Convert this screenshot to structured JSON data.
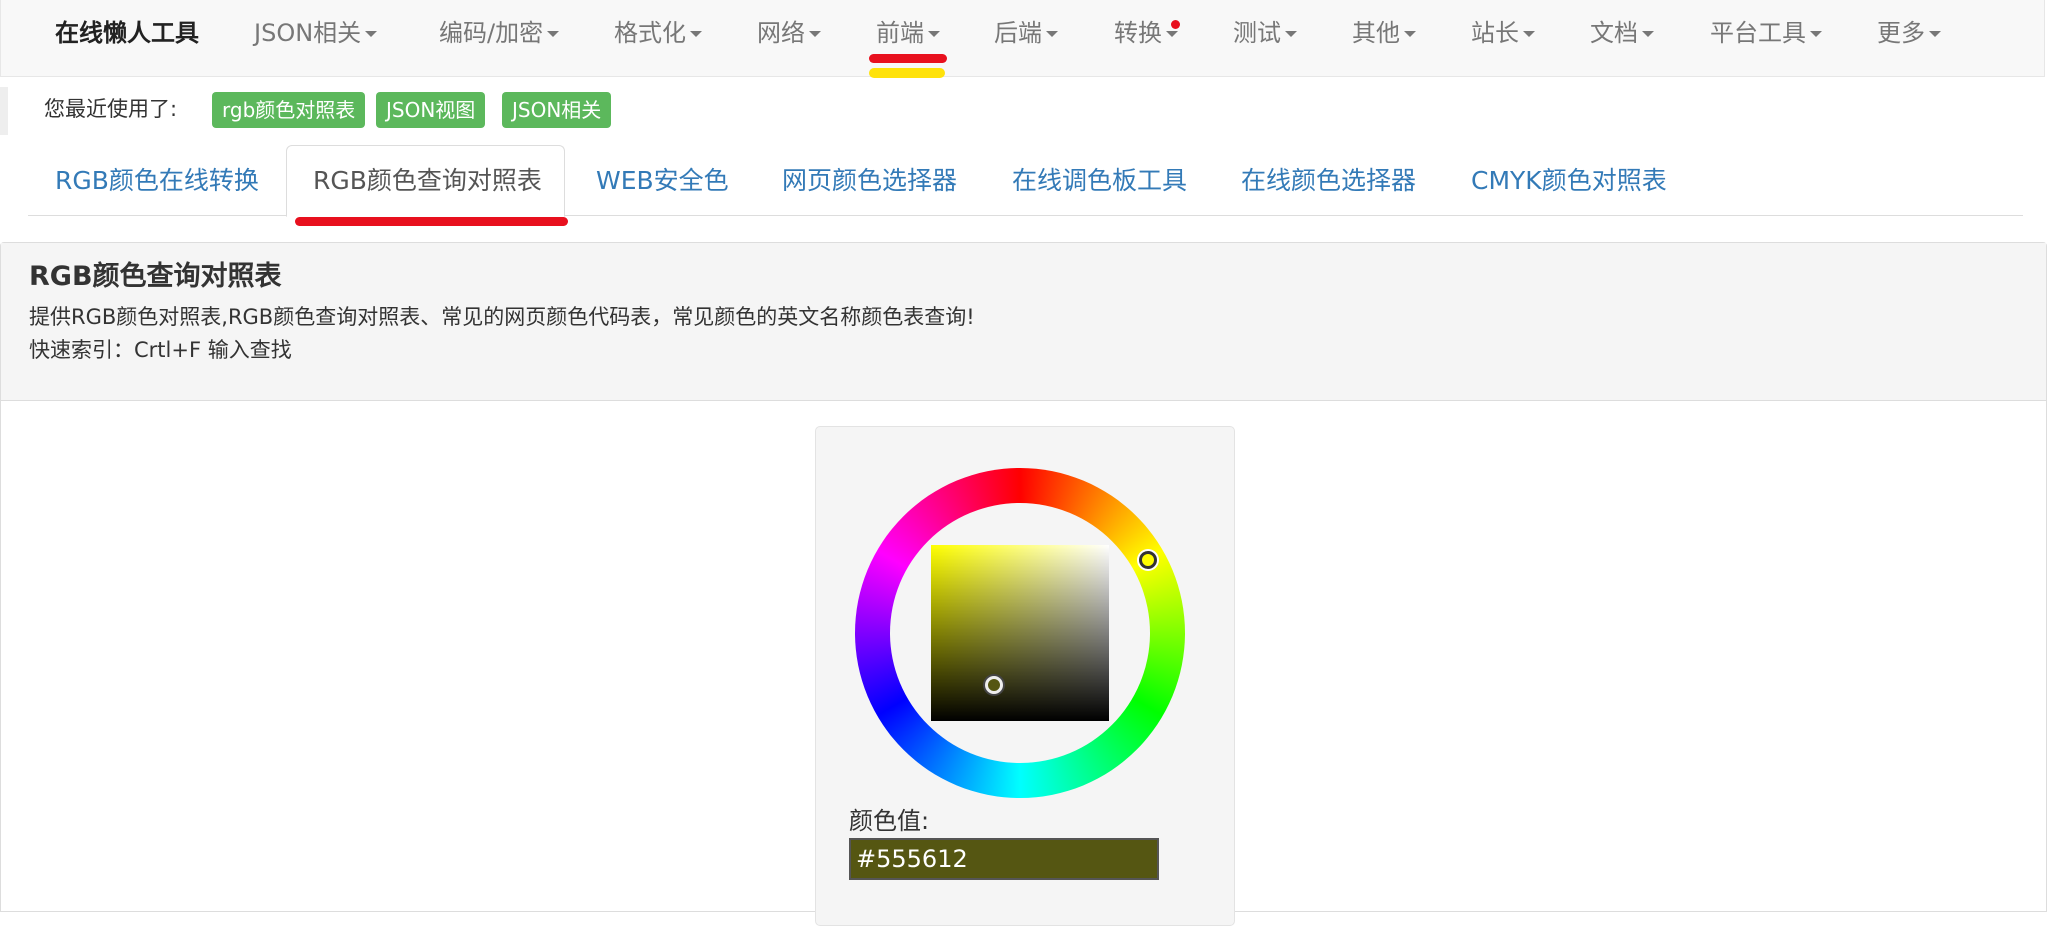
{
  "navbar": {
    "brand": "在线懒人工具",
    "items": [
      {
        "label": "JSON相关"
      },
      {
        "label": "编码/加密"
      },
      {
        "label": "格式化"
      },
      {
        "label": "网络"
      },
      {
        "label": "前端"
      },
      {
        "label": "后端"
      },
      {
        "label": "转换"
      },
      {
        "label": "测试"
      },
      {
        "label": "其他"
      },
      {
        "label": "站长"
      },
      {
        "label": "文档"
      },
      {
        "label": "平台工具"
      },
      {
        "label": "更多"
      }
    ]
  },
  "recent": {
    "label": "您最近使用了:",
    "chips": [
      "rgb颜色对照表",
      "JSON视图",
      "JSON相关"
    ]
  },
  "tabs": [
    {
      "label": "RGB颜色在线转换"
    },
    {
      "label": "RGB颜色查询对照表",
      "active": true
    },
    {
      "label": "WEB安全色"
    },
    {
      "label": "网页颜色选择器"
    },
    {
      "label": "在线调色板工具"
    },
    {
      "label": "在线颜色选择器"
    },
    {
      "label": "CMYK颜色对照表"
    }
  ],
  "panel": {
    "title": "RGB颜色查询对照表",
    "description": "提供RGB颜色对照表,RGB颜色查询对照表、常见的网页颜色代码表，常见颜色的英文名称颜色表查询!",
    "index_hint": "快速索引：Crtl+F 输入查找"
  },
  "picker": {
    "value_label": "颜色值:",
    "value": "#555612",
    "hue_color": "#ffff00"
  },
  "colors": {
    "link": "#337ab7",
    "chip_bg": "#5cb85c",
    "nav_text": "#777777",
    "highlight_red": "#e8101e",
    "highlight_yellow": "#ffe20a"
  }
}
